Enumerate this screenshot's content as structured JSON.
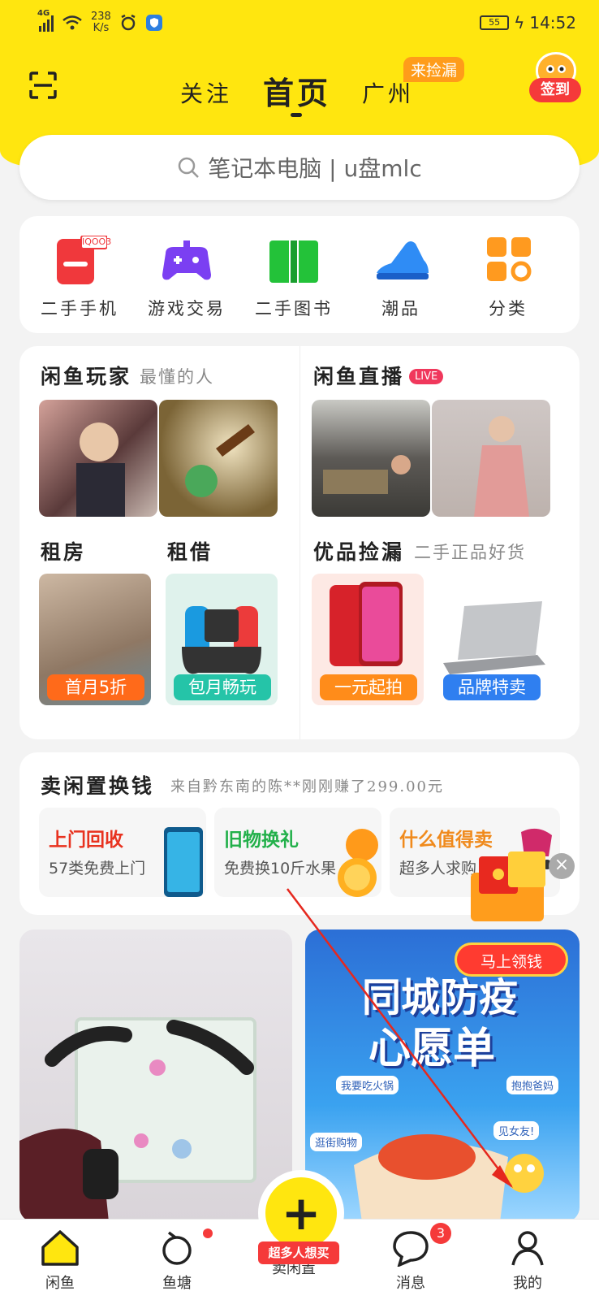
{
  "status_bar": {
    "network": "4G",
    "speed_value": "238",
    "speed_unit": "K/s",
    "battery": "55",
    "time": "14:52"
  },
  "header": {
    "tabs": [
      "关注",
      "首页",
      "广州"
    ],
    "active_tab": "首页",
    "city_badge": "来捡漏",
    "signin_label": "签到"
  },
  "search": {
    "placeholder": "笔记本电脑 | u盘mlc"
  },
  "categories": [
    {
      "label": "二手手机",
      "badge": "IQOO3",
      "icon": "phone-icon"
    },
    {
      "label": "游戏交易",
      "icon": "gamepad-icon"
    },
    {
      "label": "二手图书",
      "icon": "book-icon"
    },
    {
      "label": "潮品",
      "icon": "sneaker-icon"
    },
    {
      "label": "分类",
      "icon": "grid-icon"
    }
  ],
  "sections": {
    "players": {
      "title": "闲鱼玩家",
      "subtitle": "最懂的人"
    },
    "live": {
      "title": "闲鱼直播",
      "badge": "LIVE"
    },
    "rent": {
      "title": "租房",
      "pill": "首月5折"
    },
    "borrow": {
      "title": "租借",
      "pill": "包月畅玩"
    },
    "picks": {
      "title": "优品捡漏",
      "subtitle": "二手正品好货",
      "pill1": "一元起拍",
      "pill2": "品牌特卖"
    }
  },
  "sell": {
    "title": "卖闲置换钱",
    "ticker": "来自黔东南的陈**刚刚赚了299.00元",
    "boxes": [
      {
        "title": "上门回收",
        "sub": "57类免费上门",
        "color": "#e8321f"
      },
      {
        "title": "旧物换礼",
        "sub": "免费换10斤水果",
        "color": "#22b04a"
      },
      {
        "title": "什么值得卖",
        "sub": "超多人求购",
        "color": "#f08a1c"
      }
    ]
  },
  "promo": {
    "button": "马上领钱",
    "banner_title_1": "同城防疫",
    "banner_title_2": "心愿单",
    "tags": [
      "我要吃火锅",
      "抱抱爸妈",
      "逛街购物",
      "见女友!"
    ]
  },
  "nav": {
    "items": [
      "闲鱼",
      "鱼塘",
      "卖闲置",
      "消息",
      "我的"
    ],
    "fab_tag": "超多人想买",
    "message_count": "3"
  },
  "colors": {
    "brand_yellow": "#ffe60f",
    "accent_red": "#f53a3a"
  }
}
